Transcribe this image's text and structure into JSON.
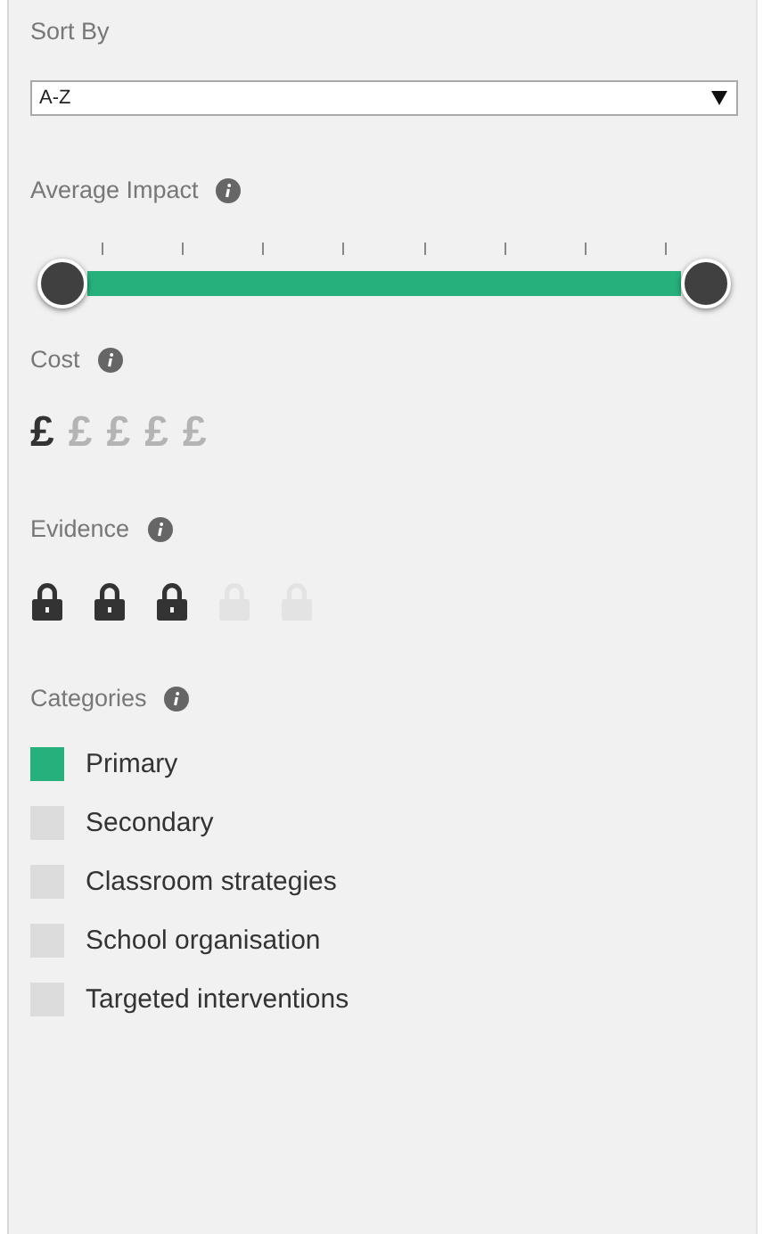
{
  "sort": {
    "label": "Sort By",
    "value": "A-Z"
  },
  "impact": {
    "label": "Average Impact",
    "level": 1
  },
  "cost": {
    "label": "Cost",
    "symbols": [
      "£",
      "£",
      "£",
      "£",
      "£"
    ],
    "stars": 1
  },
  "evidence": {
    "label": "Evidence",
    "stars": 3
  },
  "categories": {
    "label": "Categories",
    "items": [
      {
        "label": "Primary",
        "selected": true
      },
      {
        "label": "Secondary",
        "selected": false
      },
      {
        "label": "Classroom strategies",
        "selected": false
      },
      {
        "label": "School organisation",
        "selected": false
      },
      {
        "label": "Targeted interventions",
        "selected": false
      }
    ]
  }
}
